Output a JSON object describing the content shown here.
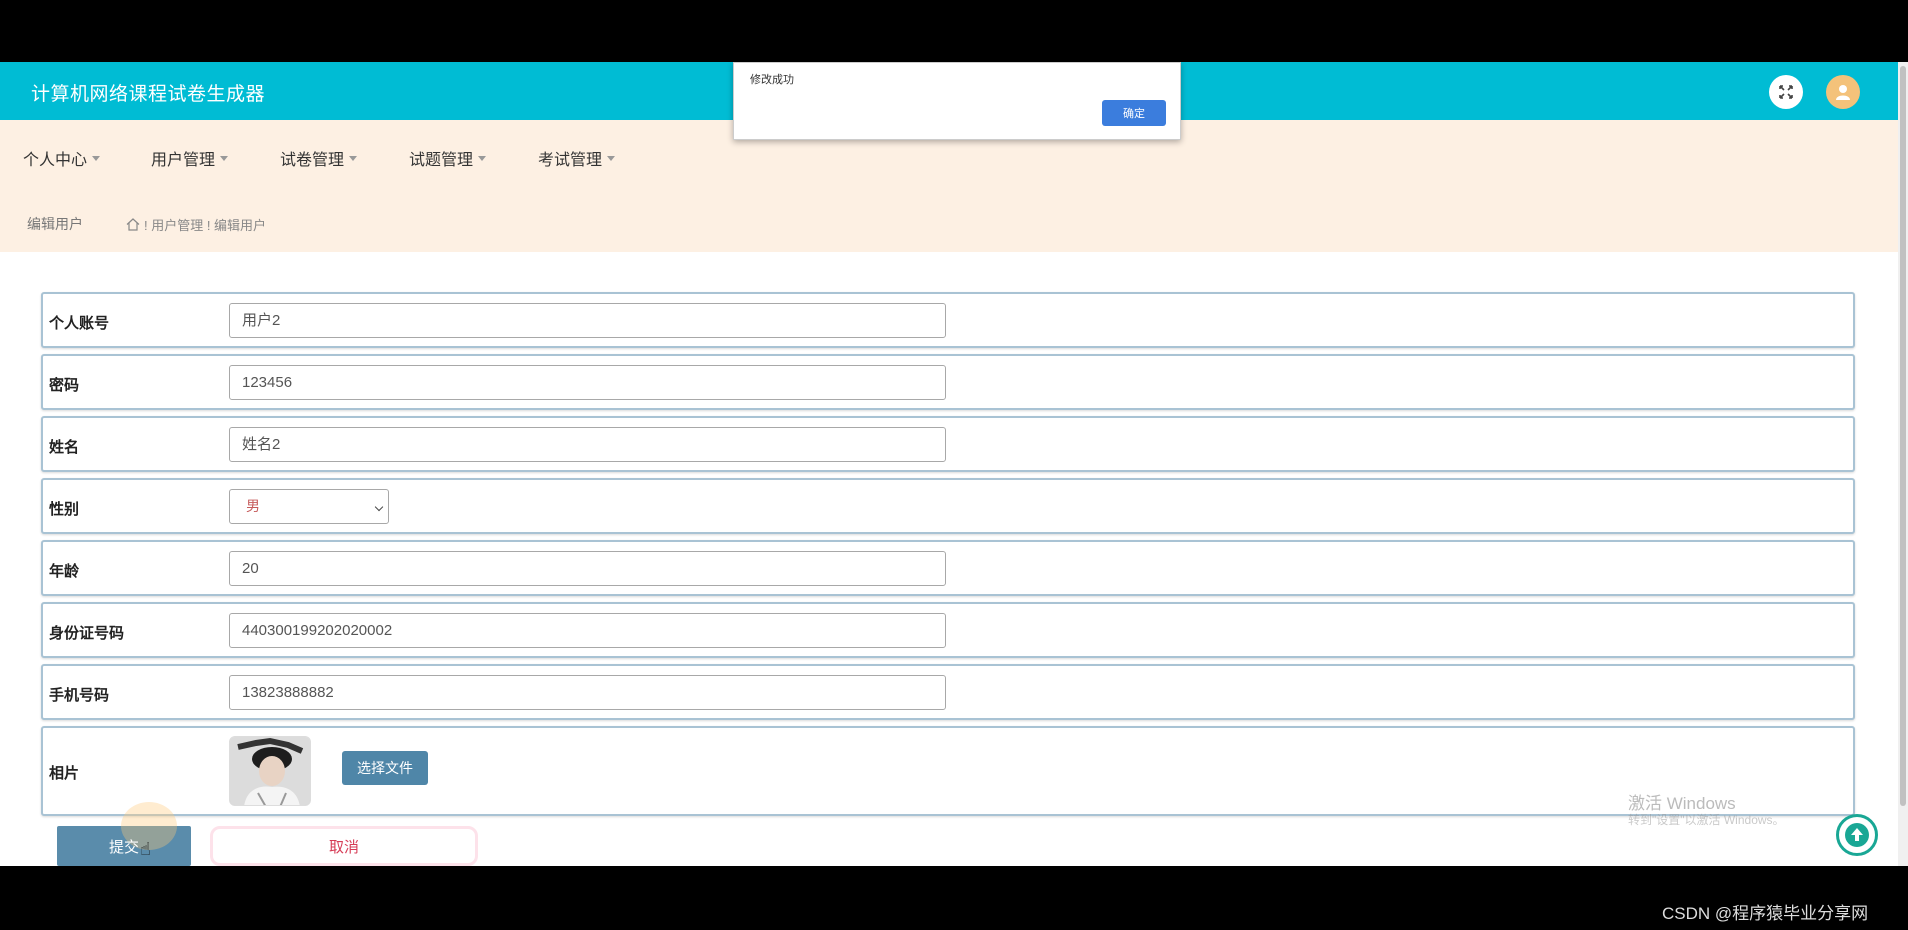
{
  "header": {
    "app_title": "计算机网络课程试卷生成器",
    "fullscreen_icon": "fullscreen-icon",
    "avatar_icon": "user-avatar-icon",
    "bar_color": "#00bcd4"
  },
  "nav": {
    "items": [
      {
        "label": "个人中心"
      },
      {
        "label": "用户管理"
      },
      {
        "label": "试卷管理"
      },
      {
        "label": "试题管理"
      },
      {
        "label": "考试管理"
      }
    ]
  },
  "breadcrumb": {
    "title": "编辑用户",
    "path": "! 用户管理 ! 编辑用户"
  },
  "form": {
    "fields": [
      {
        "label": "个人账号",
        "value": "用户2"
      },
      {
        "label": "密码",
        "value": "123456"
      },
      {
        "label": "姓名",
        "value": "姓名2"
      },
      {
        "label": "性别",
        "value": "男"
      },
      {
        "label": "年龄",
        "value": "20"
      },
      {
        "label": "身份证号码",
        "value": "440300199202020002"
      },
      {
        "label": "手机号码",
        "value": "13823888882"
      },
      {
        "label": "相片",
        "value": ""
      }
    ],
    "file_button": "选择文件",
    "submit": "提交",
    "cancel": "取消"
  },
  "dialog": {
    "message": "修改成功",
    "button": "确定"
  },
  "watermark": {
    "line1": "激活 Windows",
    "line2": "转到\"设置\"以激活 Windows。"
  },
  "footer": {
    "credit": "CSDN @程序猿毕业分享网"
  }
}
